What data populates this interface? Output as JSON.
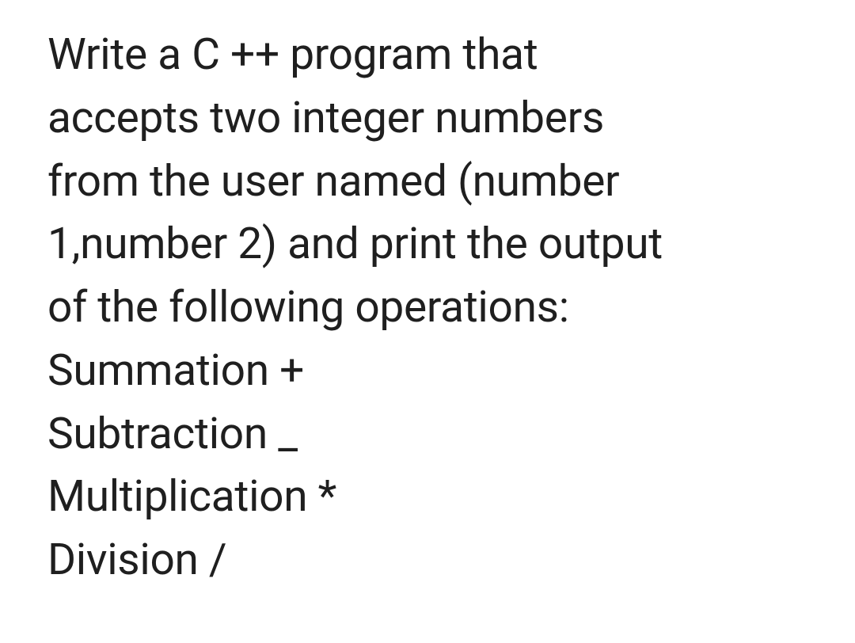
{
  "document": {
    "lines": [
      "Write a C ++ program that",
      "accepts two integer numbers",
      "from the user named (number",
      "1,number 2) and print the output",
      "of the following operations:",
      "Summation +",
      "Subtraction _",
      "Multiplication *",
      "Division /"
    ]
  }
}
